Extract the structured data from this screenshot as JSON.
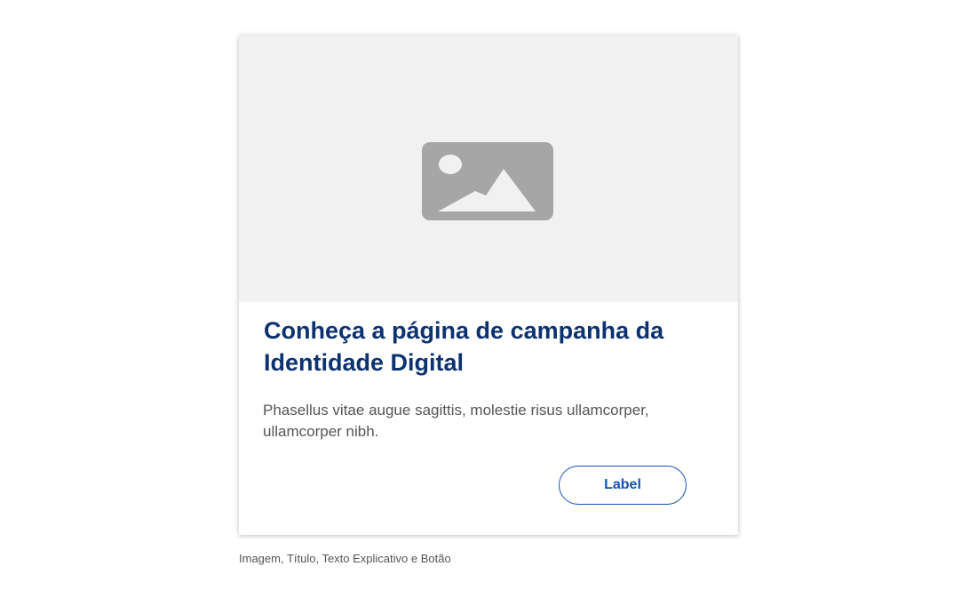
{
  "card": {
    "image_icon": "image-placeholder-icon",
    "title": "Conheça a página de campanha da Identidade Digital",
    "text": "Phasellus vitae augue sagittis, molestie risus ullamcorper, ullamcorper nibh.",
    "button_label": "Label"
  },
  "caption": "Imagem, Título, Texto Explicativo e Botão",
  "colors": {
    "title": "#0c326f",
    "accent": "#1351b4",
    "body_text": "#555555",
    "image_background": "#f1f1f1",
    "icon": "#a6a6a6"
  }
}
